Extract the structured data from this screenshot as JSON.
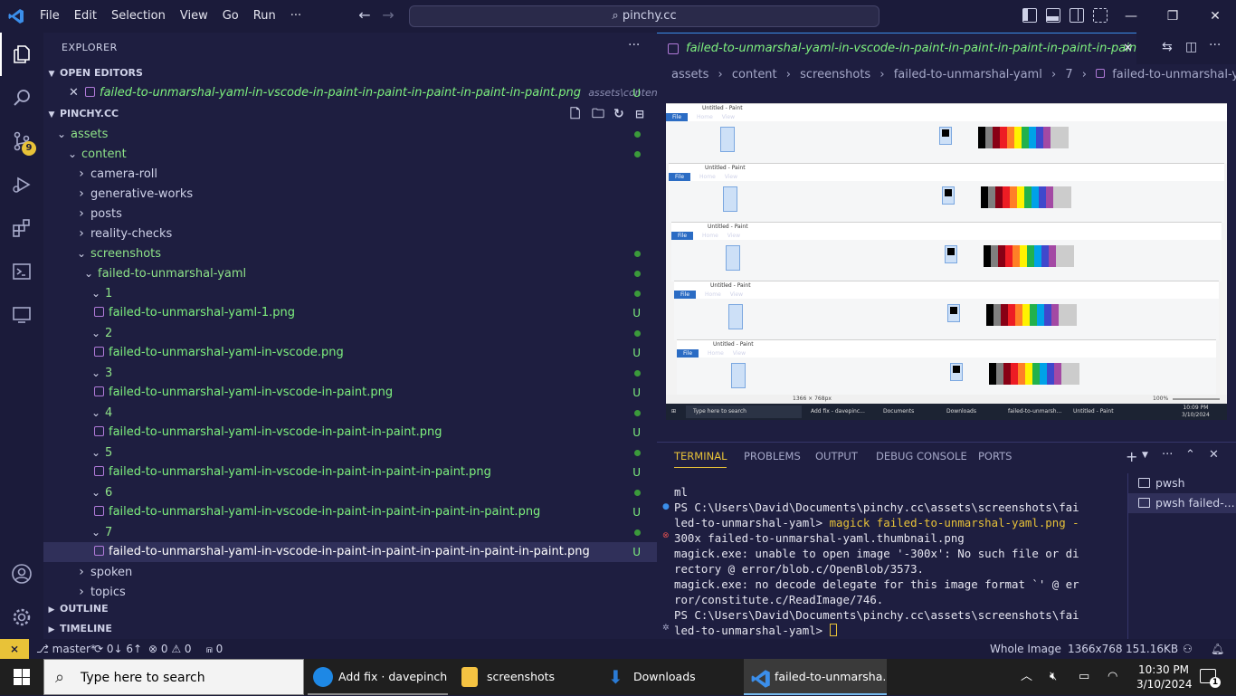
{
  "titlebar": {
    "menus": [
      "File",
      "Edit",
      "Selection",
      "View",
      "Go",
      "Run",
      "···"
    ],
    "command_center": "pinchy.cc"
  },
  "activity": {
    "scm_badge": "9"
  },
  "explorer": {
    "title": "EXPLORER",
    "more": "···",
    "open_editors_label": "OPEN EDITORS",
    "open_editor_file": "failed-to-unmarshal-yaml-in-vscode-in-paint-in-paint-in-paint-in-paint-in-paint.png",
    "open_editor_path": "assets\\content\\scre...",
    "open_editor_status": "U",
    "workspace_label": "PINCHY.CC",
    "tree": [
      {
        "label": "assets",
        "kind": "folder",
        "level": 0,
        "dot": true
      },
      {
        "label": "content",
        "kind": "folder",
        "level": 1,
        "dot": true
      },
      {
        "label": "camera-roll",
        "kind": "folder-closed",
        "level": 2
      },
      {
        "label": "generative-works",
        "kind": "folder-closed",
        "level": 2
      },
      {
        "label": "posts",
        "kind": "folder-closed",
        "level": 2
      },
      {
        "label": "reality-checks",
        "kind": "folder-closed",
        "level": 2
      },
      {
        "label": "screenshots",
        "kind": "folder",
        "level": 2,
        "dot": true
      },
      {
        "label": "failed-to-unmarshal-yaml",
        "kind": "folder",
        "level": 3,
        "dot": true
      },
      {
        "label": "1",
        "kind": "folder",
        "level": 4,
        "dot": true
      },
      {
        "label": "failed-to-unmarshal-yaml-1.png",
        "kind": "file",
        "level": 5,
        "status": "U"
      },
      {
        "label": "2",
        "kind": "folder",
        "level": 4,
        "dot": true
      },
      {
        "label": "failed-to-unmarshal-yaml-in-vscode.png",
        "kind": "file",
        "level": 5,
        "status": "U"
      },
      {
        "label": "3",
        "kind": "folder",
        "level": 4,
        "dot": true
      },
      {
        "label": "failed-to-unmarshal-yaml-in-vscode-in-paint.png",
        "kind": "file",
        "level": 5,
        "status": "U"
      },
      {
        "label": "4",
        "kind": "folder",
        "level": 4,
        "dot": true
      },
      {
        "label": "failed-to-unmarshal-yaml-in-vscode-in-paint-in-paint.png",
        "kind": "file",
        "level": 5,
        "status": "U"
      },
      {
        "label": "5",
        "kind": "folder",
        "level": 4,
        "dot": true
      },
      {
        "label": "failed-to-unmarshal-yaml-in-vscode-in-paint-in-paint-in-paint.png",
        "kind": "file",
        "level": 5,
        "status": "U"
      },
      {
        "label": "6",
        "kind": "folder",
        "level": 4,
        "dot": true
      },
      {
        "label": "failed-to-unmarshal-yaml-in-vscode-in-paint-in-paint-in-paint-in-paint.png",
        "kind": "file",
        "level": 5,
        "status": "U"
      },
      {
        "label": "7",
        "kind": "folder",
        "level": 4,
        "dot": true
      },
      {
        "label": "failed-to-unmarshal-yaml-in-vscode-in-paint-in-paint-in-paint-in-paint-in-paint.png",
        "kind": "file",
        "level": 5,
        "status": "U",
        "selected": true
      },
      {
        "label": "spoken",
        "kind": "folder-closed",
        "level": 2
      },
      {
        "label": "topics",
        "kind": "folder-closed",
        "level": 2
      }
    ],
    "outline_label": "OUTLINE",
    "timeline_label": "TIMELINE"
  },
  "editor": {
    "tab_label": "failed-to-unmarshal-yaml-in-vscode-in-paint-in-paint-in-paint-in-paint-in-paint.png",
    "tab_status": "U",
    "breadcrumb": [
      "assets",
      "content",
      "screenshots",
      "failed-to-unmarshal-yaml",
      "7",
      "failed-to-unmarshal-yaml-in-vscode-in"
    ],
    "image": {
      "paint_window_title": "Untitled - Paint",
      "status_text": "1366 × 768px",
      "zoom": "100%",
      "taskbar_search": "Type here to search",
      "taskbar_apps": [
        "Add fix - davepinc...",
        "Documents",
        "Downloads",
        "failed-to-unmarsh...",
        "Untitled - Paint"
      ],
      "clock": "10:09 PM",
      "date": "3/10/2024"
    }
  },
  "panel": {
    "tabs": [
      "TERMINAL",
      "PROBLEMS",
      "OUTPUT",
      "DEBUG CONSOLE",
      "PORTS"
    ],
    "terminal_lines": [
      "ml",
      "PS C:\\Users\\David\\Documents\\pinchy.cc\\assets\\screenshots\\fai",
      "led-to-unmarshal-yaml> ",
      "300x failed-to-unmarshal-yaml.thumbnail.png",
      "magick.exe: unable to open image '-300x': No such file or di",
      "rectory @ error/blob.c/OpenBlob/3573.",
      "magick.exe: no decode delegate for this image format `' @ er",
      "ror/constitute.c/ReadImage/746.",
      "PS C:\\Users\\David\\Documents\\pinchy.cc\\assets\\screenshots\\fai",
      "led-to-unmarshal-yaml> "
    ],
    "command": "magick failed-to-unmarshal-yaml.png -",
    "terminals": [
      "pwsh",
      "pwsh failed-..."
    ]
  },
  "statusbar": {
    "branch": "master*",
    "sync": "0↓ 6↑",
    "problems": "⊗ 0 ⚠ 0",
    "ports": "0",
    "view_mode": "Whole Image",
    "dimensions": "1366x768",
    "size": "151.16KB"
  },
  "taskbar": {
    "search_placeholder": "Type here to search",
    "apps": [
      {
        "label": "Add fix · davepinch...",
        "color": "#1e88e5"
      },
      {
        "label": "screenshots",
        "color": "#f5c342"
      },
      {
        "label": "Downloads",
        "color": "#2a7bd6"
      },
      {
        "label": "failed-to-unmarsha...",
        "color": "#1e6fc4"
      }
    ],
    "time": "10:30 PM",
    "date": "3/10/2024",
    "notifications": "1"
  }
}
